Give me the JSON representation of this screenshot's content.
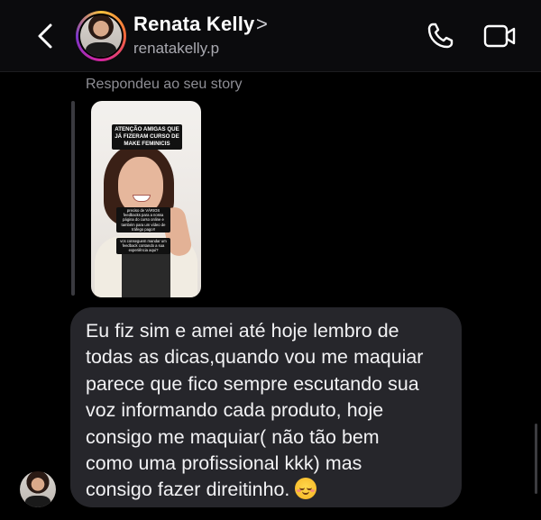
{
  "header": {
    "contact_name": "Renata Kelly",
    "name_chevron": ">",
    "handle": "renatakelly.p",
    "back_icon": "chevron-left-icon",
    "call_icon": "phone-icon",
    "video_icon": "video-camera-icon"
  },
  "thread": {
    "reply_label": "Respondeu ao seu story",
    "story": {
      "banner_text": "ATENÇÃO AMIGAS QUE JÁ FIZERAM CURSO DE MAKE FEMINICIS",
      "note_1": "preciso de VÁRIOS feedbacks para a nossa página do curso online e também para um vídeo de tráfego pago!!",
      "note_2": "vcs conseguem mandar um feedback contando a sua experiência aqui?"
    },
    "message": {
      "lines": [
        "Eu fiz sim e amei até hoje lembro de",
        "todas as dicas,quando vou me maquiar",
        "parece que fico sempre escutando sua",
        "voz informando cada produto, hoje",
        "consigo me maquiar( não tão bem",
        "como uma profissional kkk) mas",
        "consigo fazer direitinho."
      ],
      "emoji": "smiling-face-icon"
    }
  },
  "colors": {
    "background": "#000000",
    "bubble": "#26262b",
    "secondary_text": "#8e8e95",
    "story_ring": [
      "#f9c23c",
      "#f5653b",
      "#d6249f",
      "#7b35c9"
    ]
  }
}
